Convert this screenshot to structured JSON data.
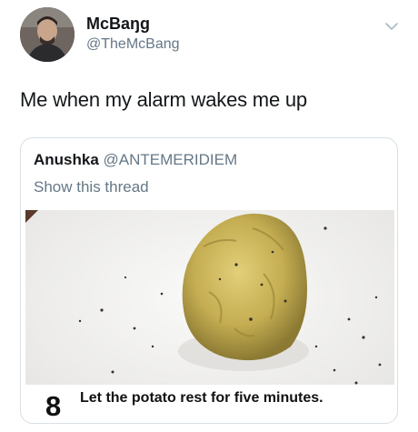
{
  "tweet": {
    "display_name": "McBaŋg",
    "handle": "@TheMcBang",
    "text": "Me when my alarm wakes me up",
    "icons": {
      "avatar": "profile-photo",
      "menu": "chevron-down-icon"
    }
  },
  "quoted_tweet": {
    "author_name": "Anushka",
    "author_handle": "@ANTEMERIDIEM",
    "thread_link": "Show this thread",
    "media": {
      "image": "baked-potato-on-white-plate",
      "step_number": "8",
      "step_text": "Let the potato rest for five minutes."
    }
  },
  "colors": {
    "text_primary": "#14171a",
    "text_secondary": "#657786",
    "card_border": "#d8dfe4",
    "plate": "#f2f2f1",
    "potato": "#c9b45a"
  }
}
